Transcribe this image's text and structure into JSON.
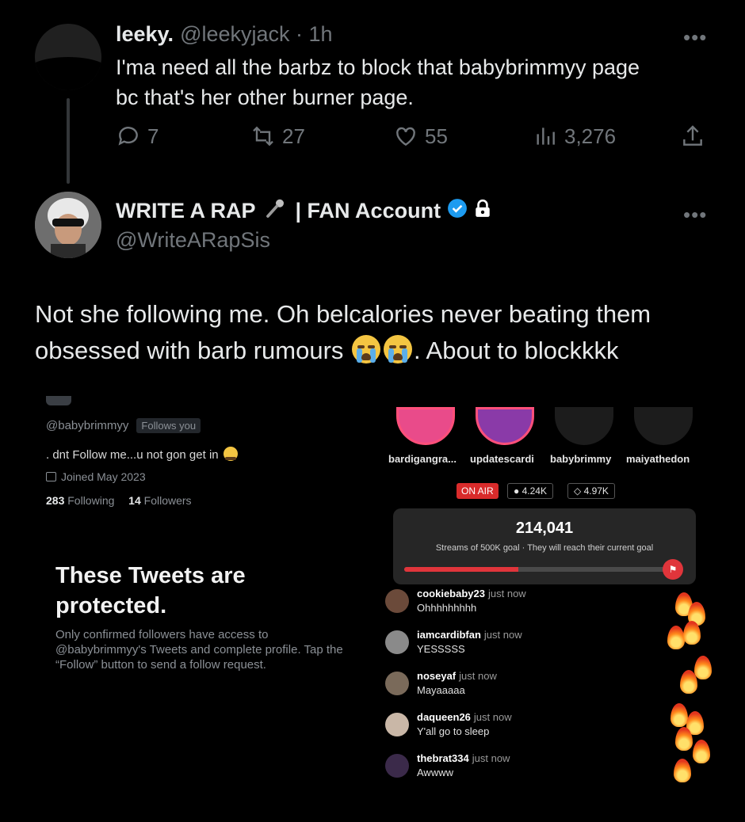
{
  "tweet1": {
    "name": "leeky.",
    "meta": "@leekyjack · 1h",
    "text_line1": "I'ma need all the barbz to block that babybrimmyy page",
    "text_line2": "bc that's her other burner page.",
    "more": "•••",
    "replies": "7",
    "retweets": "27",
    "likes": "55",
    "views": "3,276"
  },
  "tweet2": {
    "name_part1": "WRITE A RAP",
    "name_part2": "| FAN Account",
    "handle": "@WriteARapSis",
    "more": "•••",
    "text_part1": "Not she following me. Oh belcalories never beating them obsessed with barb rumours",
    "text_part2": ". About to blockkkk"
  },
  "profile_shot": {
    "handle": "@babybrimmyy",
    "follows_you": "Follows you",
    "bio": ". dnt Follow me...u not gon get in",
    "joined": "Joined May 2023",
    "following_count": "283",
    "following_label": "Following",
    "followers_count": "14",
    "followers_label": "Followers",
    "protected_title": "These Tweets are protected.",
    "protected_text": "Only confirmed followers have access to @babybrimmyy's Tweets and complete profile. Tap the “Follow” button to send a follow request."
  },
  "live_shot": {
    "stories": [
      "bardigangra...",
      "updatescardi",
      "babybrimmy",
      "maiyathedon"
    ],
    "on_air": "ON AIR",
    "viewers": "4.24K",
    "diamonds": "4.97K",
    "goal_number": "214,041",
    "goal_text": "Streams of 500K goal · They will reach their current goal",
    "goal_progress": 0.43,
    "comments": [
      {
        "user": "cookiebaby23",
        "time": "just now",
        "msg": "Ohhhhhhhhh",
        "color": "#6b4a3a"
      },
      {
        "user": "iamcardibfan",
        "time": "just now",
        "msg": "YESSSSS",
        "color": "#8a8a8a"
      },
      {
        "user": "noseyaf",
        "time": "just now",
        "msg": "Mayaaaaa",
        "color": "#7a6a5a"
      },
      {
        "user": "daqueen26",
        "time": "just now",
        "msg": "Y'all go to sleep",
        "color": "#c9b7a7"
      },
      {
        "user": "thebrat334",
        "time": "just now",
        "msg": "Awwww",
        "color": "#3b2a4a"
      }
    ]
  },
  "colors": {
    "background": "#000000",
    "muted": "#71767b",
    "verified": "#1d9bf0",
    "live_red": "#e0353b"
  }
}
